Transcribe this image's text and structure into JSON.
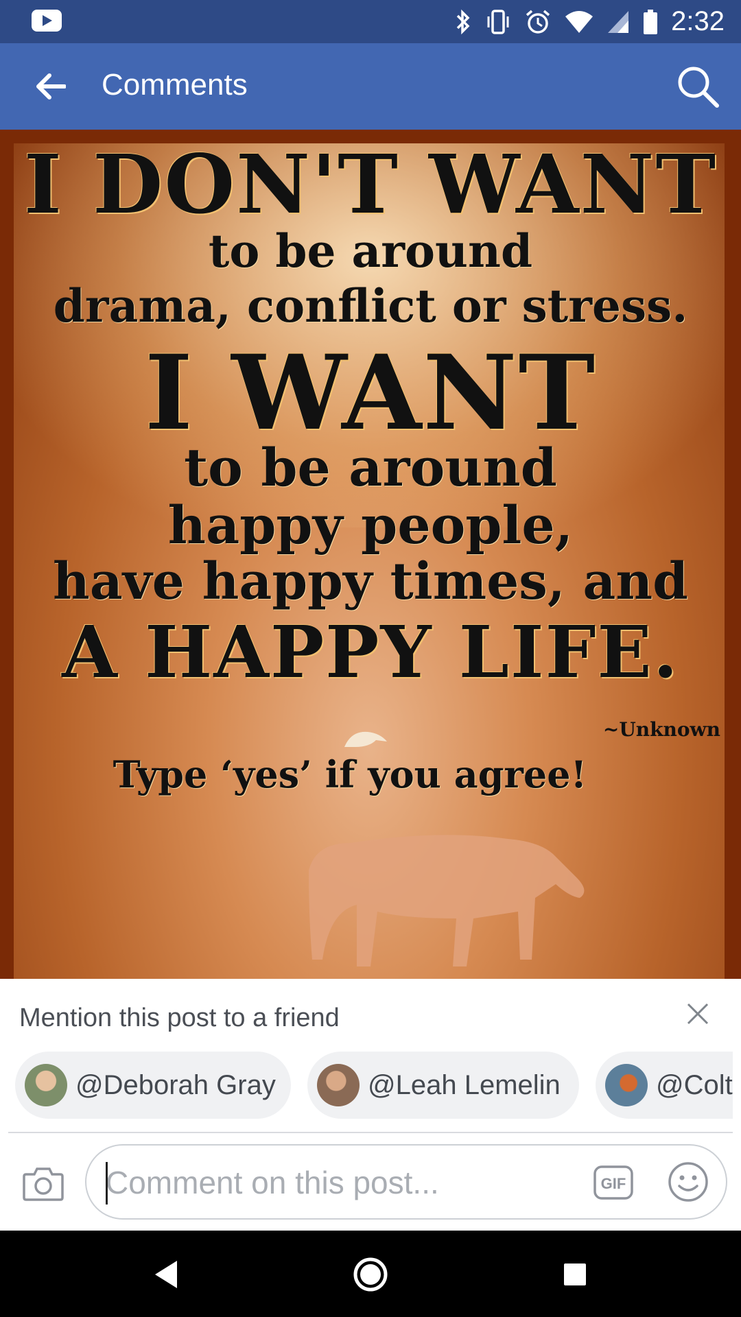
{
  "status_bar": {
    "time": "2:32",
    "icons": [
      "youtube-icon",
      "bluetooth-icon",
      "vibrate-icon",
      "alarm-icon",
      "wifi-icon",
      "signal-icon",
      "battery-icon"
    ]
  },
  "app_bar": {
    "title": "Comments",
    "back_icon": "arrow-left-icon",
    "search_icon": "search-icon"
  },
  "post": {
    "quote_lines": [
      "I DON'T WANT",
      "to be around",
      "drama, conflict or stress.",
      "I WANT",
      "to be around",
      "happy people,",
      "have happy times, and",
      "A HAPPY LIFE."
    ],
    "attribution": "~Unknown",
    "call_to_action": "Type ‘yes’ if you agree!"
  },
  "mention_panel": {
    "title": "Mention this post to a friend",
    "friends": [
      {
        "label": "@Deborah Gray",
        "avatar_color": "#7d8f6a"
      },
      {
        "label": "@Leah Lemelin",
        "avatar_color": "#8a6a55"
      },
      {
        "label": "@Colt",
        "avatar_color": "#5c7f9a"
      }
    ]
  },
  "composer": {
    "placeholder": "Comment on this post...",
    "gif_label": "GIF"
  },
  "colors": {
    "status_bar": "#2e4a86",
    "app_bar": "#4267b2",
    "chip_bg": "#f0f1f3"
  }
}
